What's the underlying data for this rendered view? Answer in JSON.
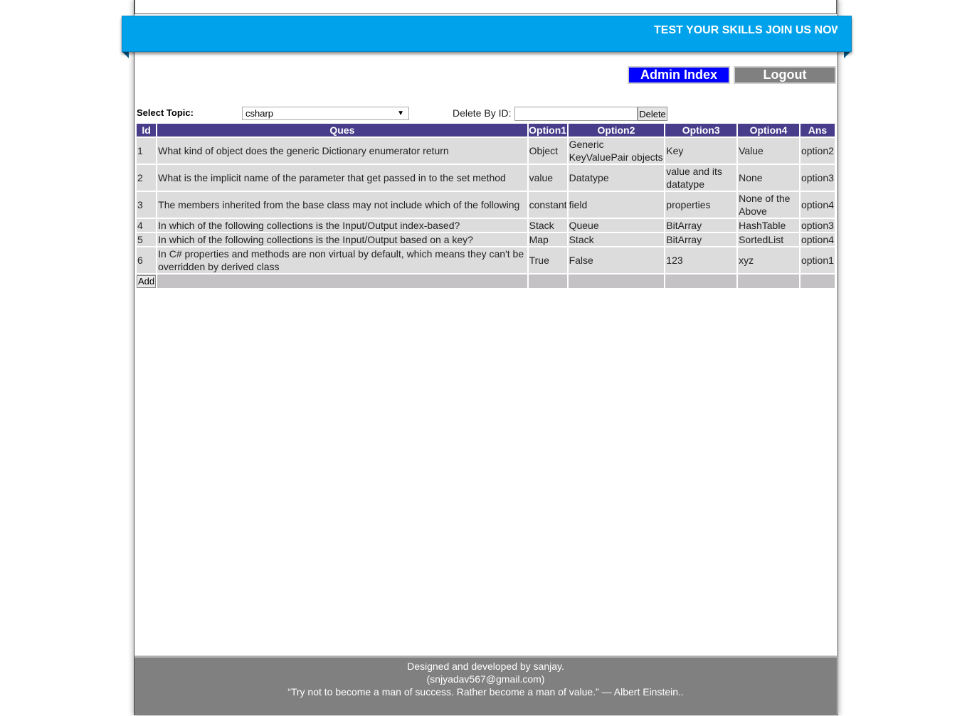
{
  "banner": {
    "marquee_text": "TEST YOUR SKILLS JOIN US NOW",
    "color": "#00a3eb"
  },
  "nav": {
    "admin_index_label": "Admin Index",
    "logout_label": "Logout",
    "admin_color": "#0000ff",
    "logout_color": "#808080"
  },
  "filters": {
    "topic_label": "Select Topic:",
    "topic_selected": "csharp",
    "topic_arrow_icon": "dropdown-arrow-icon",
    "delete_label": "Delete By ID:",
    "delete_input_value": "",
    "delete_button_label": "Delete"
  },
  "table": {
    "header_color": "#483d8b",
    "columns": [
      "Id",
      "Ques",
      "Option1",
      "Option2",
      "Option3",
      "Option4",
      "Ans"
    ],
    "rows": [
      {
        "id": "1",
        "ques": "What kind of object does the generic Dictionary enumerator return",
        "option1": "Object",
        "option2": "Generic KeyValuePair objects",
        "option3": "Key",
        "option4": "Value",
        "ans": "option2"
      },
      {
        "id": "2",
        "ques": "What is the implicit name of the parameter that get passed in to the set method",
        "option1": "value",
        "option2": "Datatype",
        "option3": "value and its datatype",
        "option4": "None",
        "ans": "option3"
      },
      {
        "id": "3",
        "ques": "The members inherited from the base class may not include which of the following",
        "option1": "constant",
        "option2": "field",
        "option3": "properties",
        "option4": "None of the Above",
        "ans": "option4"
      },
      {
        "id": "4",
        "ques": "In which of the following collections is the Input/Output index-based?",
        "option1": "Stack",
        "option2": "Queue",
        "option3": "BitArray",
        "option4": "HashTable",
        "ans": "option3"
      },
      {
        "id": "5",
        "ques": "In which of the following collections is the Input/Output based on a key?",
        "option1": "Map",
        "option2": "Stack",
        "option3": "BitArray",
        "option4": "SortedList",
        "ans": "option4"
      },
      {
        "id": "6",
        "ques": "In C# properties and methods are non virtual by default, which means they can't be overridden by derived class",
        "option1": "True",
        "option2": "False",
        "option3": "123",
        "option4": "xyz",
        "ans": "option1"
      }
    ],
    "add_button_label": "Add"
  },
  "footer": {
    "line1": "Designed and developed by sanjay.",
    "line2": "(snjyadav567@gmail.com)",
    "line3": "“Try not to become a man of success. Rather become a man of value.” — Albert Einstein.."
  }
}
